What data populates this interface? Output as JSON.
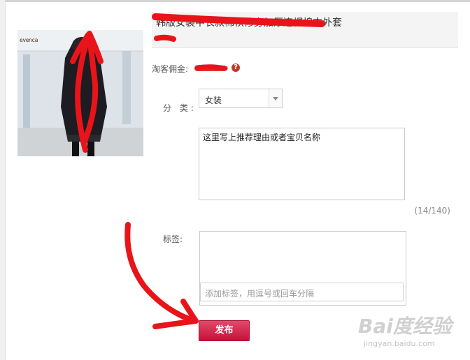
{
  "product": {
    "title": "韩版女装中长款棉袄修身加厚连帽棉衣外套",
    "image_brand": "evenca"
  },
  "commission": {
    "label": "淘客佣金:",
    "help_icon": "?"
  },
  "category": {
    "label": "分 类:",
    "selected": "女装"
  },
  "reason": {
    "value": "这里写上推荐理由或者宝贝名称",
    "count": "(14/140)"
  },
  "tags": {
    "label": "标签:",
    "placeholder": "添加标签，用逗号或回车分隔"
  },
  "actions": {
    "publish": "发布"
  },
  "watermark": {
    "main": "Bai度经验",
    "sub": "jingyan.baidu.com"
  },
  "colors": {
    "annotation": "#e8141a",
    "publish": "#c8103a"
  }
}
